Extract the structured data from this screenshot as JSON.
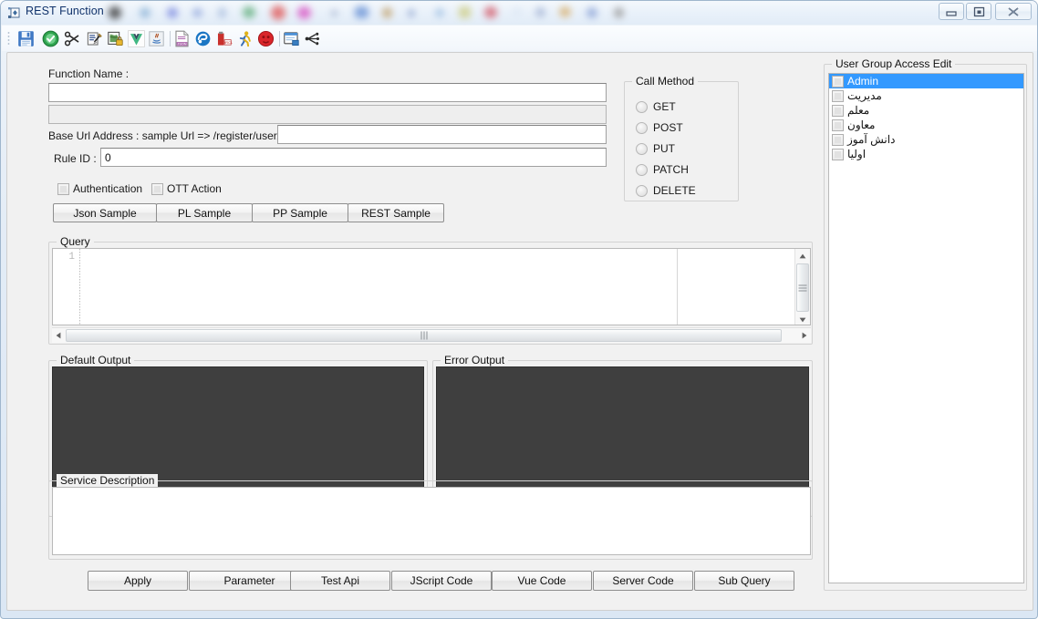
{
  "window": {
    "title": "REST Function",
    "icon": "form-plugin-icon",
    "controls": {
      "minimize": "minimize-icon",
      "maximize": "restore-icon",
      "close": "close-icon"
    }
  },
  "toolbar": {
    "items": [
      {
        "name": "save-icon",
        "glyph": "save"
      },
      {
        "name": "check-ok-icon",
        "glyph": "check"
      },
      {
        "name": "cut-scissors-icon",
        "glyph": "scissors"
      },
      {
        "name": "edit-script-icon",
        "glyph": "script"
      },
      {
        "name": "sql-lock-icon",
        "glyph": "sqllock"
      },
      {
        "name": "vue-icon",
        "glyph": "vue"
      },
      {
        "name": "java-icon",
        "glyph": "java"
      },
      {
        "name": "json-file-icon",
        "glyph": "jsonfile"
      },
      {
        "name": "database-blue-icon",
        "glyph": "dbblue"
      },
      {
        "name": "oracle-icon",
        "glyph": "oracle"
      },
      {
        "name": "run-person-icon",
        "glyph": "runner"
      },
      {
        "name": "stop-error-icon",
        "glyph": "stop"
      },
      {
        "name": "window-preview-icon",
        "glyph": "windowprev"
      },
      {
        "name": "sub-query-nodes-icon",
        "glyph": "nodes"
      }
    ]
  },
  "form": {
    "function_name_label": "Function Name :",
    "function_name_value": "",
    "function_name_placeholder": "",
    "secondary_field_value": "",
    "base_url_label": "Base Url Address :  sample Url =>  /register/user/",
    "base_url_value": "",
    "rule_id_label": "Rule ID :",
    "rule_id_value": "0",
    "authentication_label": "Authentication",
    "authentication_checked": false,
    "ott_action_label": "OTT Action",
    "ott_action_checked": false,
    "sample_buttons": [
      "Json Sample",
      "PL Sample",
      "PP Sample",
      "REST Sample"
    ]
  },
  "call_method": {
    "title": "Call Method",
    "options": [
      {
        "label": "GET",
        "selected": false
      },
      {
        "label": "POST",
        "selected": false
      },
      {
        "label": "PUT",
        "selected": false
      },
      {
        "label": "PATCH",
        "selected": false
      },
      {
        "label": "DELETE",
        "selected": false
      }
    ]
  },
  "query": {
    "title": "Query",
    "line_number": "1",
    "content": ""
  },
  "outputs": {
    "default_title": "Default Output",
    "default_content": "",
    "error_title": "Error Output",
    "error_content": "",
    "console_bg": "#3f3f3f"
  },
  "service_description": {
    "title": "Service Description",
    "content": ""
  },
  "action_buttons": [
    "Apply",
    "Parameter",
    "Test Api",
    "JScript Code",
    "Vue Code",
    "Server Code",
    "Sub Query"
  ],
  "user_group_access": {
    "title": "User Group Access Edit",
    "rows": [
      {
        "label": "Admin",
        "checked": false,
        "selected": true,
        "rtl": false
      },
      {
        "label": "مدیریت",
        "checked": false,
        "selected": false,
        "rtl": true
      },
      {
        "label": "معلم",
        "checked": false,
        "selected": false,
        "rtl": true
      },
      {
        "label": "معاون",
        "checked": false,
        "selected": false,
        "rtl": true
      },
      {
        "label": "دانش آموز",
        "checked": false,
        "selected": false,
        "rtl": true
      },
      {
        "label": "اولیا",
        "checked": false,
        "selected": false,
        "rtl": true
      }
    ],
    "selection_color": "#3399ff"
  },
  "colors": {
    "window_frame": "#9fb6cd",
    "client_bg": "#f1f1f1",
    "title_text": "#11336b"
  }
}
